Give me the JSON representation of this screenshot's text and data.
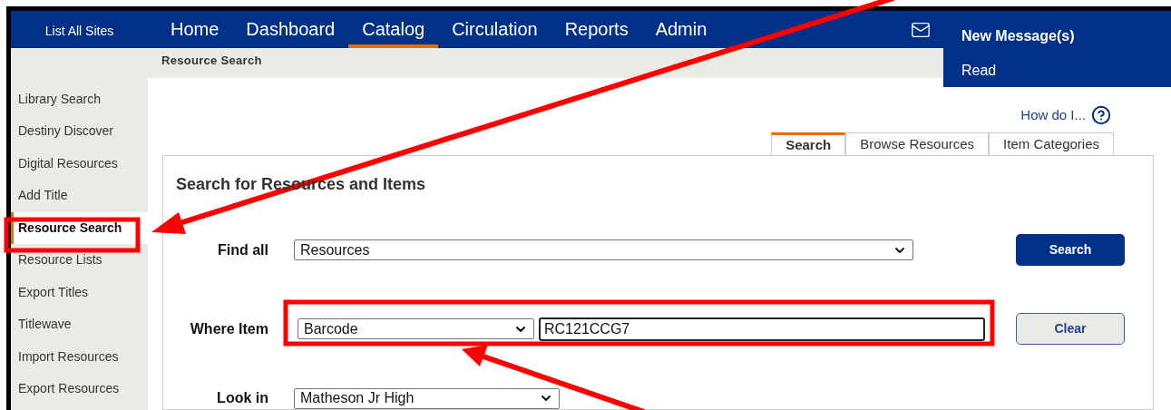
{
  "header": {
    "site_link": "List All Sites",
    "nav": [
      {
        "label": "Home",
        "selected": false
      },
      {
        "label": "Dashboard",
        "selected": false
      },
      {
        "label": "Catalog",
        "selected": true
      },
      {
        "label": "Circulation",
        "selected": false
      },
      {
        "label": "Reports",
        "selected": false
      },
      {
        "label": "Admin",
        "selected": false
      }
    ],
    "messages": {
      "title": "New Message(s)",
      "link": "Read"
    }
  },
  "breadcrumb": "Resource Search",
  "sidebar": {
    "items": [
      {
        "label": "Library Search",
        "selected": false
      },
      {
        "label": "Destiny Discover",
        "selected": false
      },
      {
        "label": "Digital Resources",
        "selected": false
      },
      {
        "label": "Add Title",
        "selected": false
      },
      {
        "label": "Resource Search",
        "selected": true
      },
      {
        "label": "Resource Lists",
        "selected": false
      },
      {
        "label": "Export Titles",
        "selected": false
      },
      {
        "label": "Titlewave",
        "selected": false
      },
      {
        "label": "Import Resources",
        "selected": false
      },
      {
        "label": "Export Resources",
        "selected": false
      }
    ]
  },
  "help_link": "How do I...",
  "tabs": [
    {
      "label": "Search",
      "selected": true
    },
    {
      "label": "Browse Resources",
      "selected": false
    },
    {
      "label": "Item Categories",
      "selected": false
    }
  ],
  "panel": {
    "title": "Search for Resources and Items",
    "find_all": {
      "label": "Find all",
      "value": "Resources"
    },
    "where_item": {
      "label": "Where Item",
      "field": "Barcode",
      "value": "RC121CCG7"
    },
    "look_in": {
      "label": "Look in",
      "value": "Matheson Jr High"
    },
    "buttons": [
      "Search",
      "Clear"
    ]
  }
}
